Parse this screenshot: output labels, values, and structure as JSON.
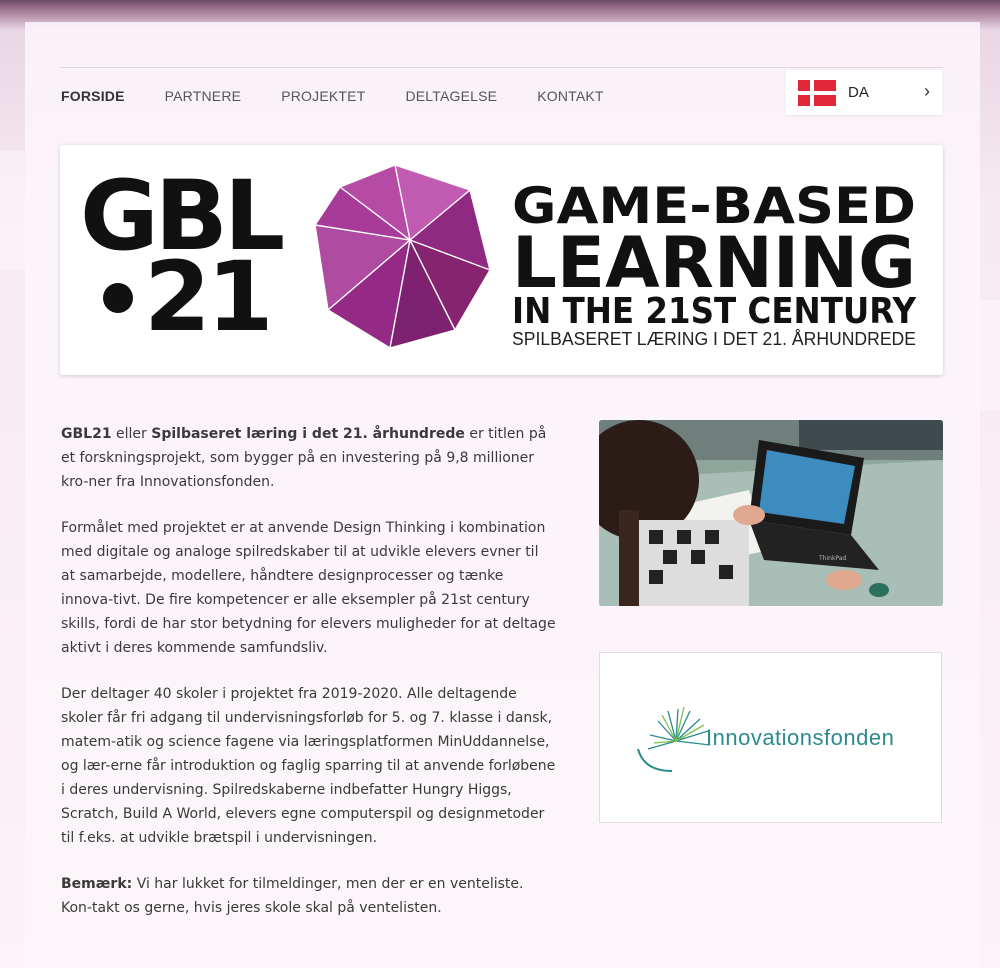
{
  "nav": {
    "items": [
      "FORSIDE",
      "PARTNERE",
      "PROJEKTET",
      "DELTAGELSE",
      "KONTAKT"
    ]
  },
  "language": {
    "label": "DA"
  },
  "banner": {
    "logo_line1": "GBL",
    "logo_line2": "21",
    "title1": "GAME-BASED",
    "title2": "LEARNING",
    "title3": "IN THE 21ST CENTURY",
    "subtitle": "SPILBASERET LÆRING I DET 21. ÅRHUNDREDE"
  },
  "content": {
    "p1_bold1": "GBL21",
    "p1_text1": " eller ",
    "p1_bold2": "Spilbaseret læring i det 21. århundrede",
    "p1_text2": " er titlen på et forskningsprojekt, som bygger på en investering på 9,8 millioner kro-ner fra Innovationsfonden.",
    "p2": "Formålet med projektet er at anvende Design Thinking i kombination med digitale og analoge spilredskaber til at udvikle elevers evner til at samarbejde, modellere, håndtere designprocesser og tænke innova-tivt. De fire kompetencer er alle eksempler på 21st century skills, fordi de har stor betydning for elevers muligheder for at deltage aktivt i deres kommende samfundsliv.",
    "p3": "Der deltager 40 skoler i projektet fra 2019-2020. Alle deltagende skoler får fri adgang til undervisningsforløb for 5. og 7. klasse i dansk, matem-atik og science fagene via læringsplatformen MinUddannelse, og lær-erne får introduktion og faglig sparring til at anvende forløbene i deres undervisning. Spilredskaberne indbefatter Hungry Higgs, Scratch, Build A World, elevers egne computerspil og designmetoder til f.eks. at udvikle brætspil i undervisningen.",
    "p4_bold": "Bemærk:",
    "p4_text": " Vi har lukket for tilmeldinger, men der er en venteliste. Kon-takt os gerne, hvis jeres skole skal på ventelisten."
  },
  "sidebar": {
    "laptop_brand": "ThinkPad",
    "sponsor_name": "Innovationsfonden"
  },
  "colors": {
    "icosahedron": "#9c2f8a",
    "sponsor_text": "#2a8a8e",
    "flag_red": "#e0283a"
  }
}
